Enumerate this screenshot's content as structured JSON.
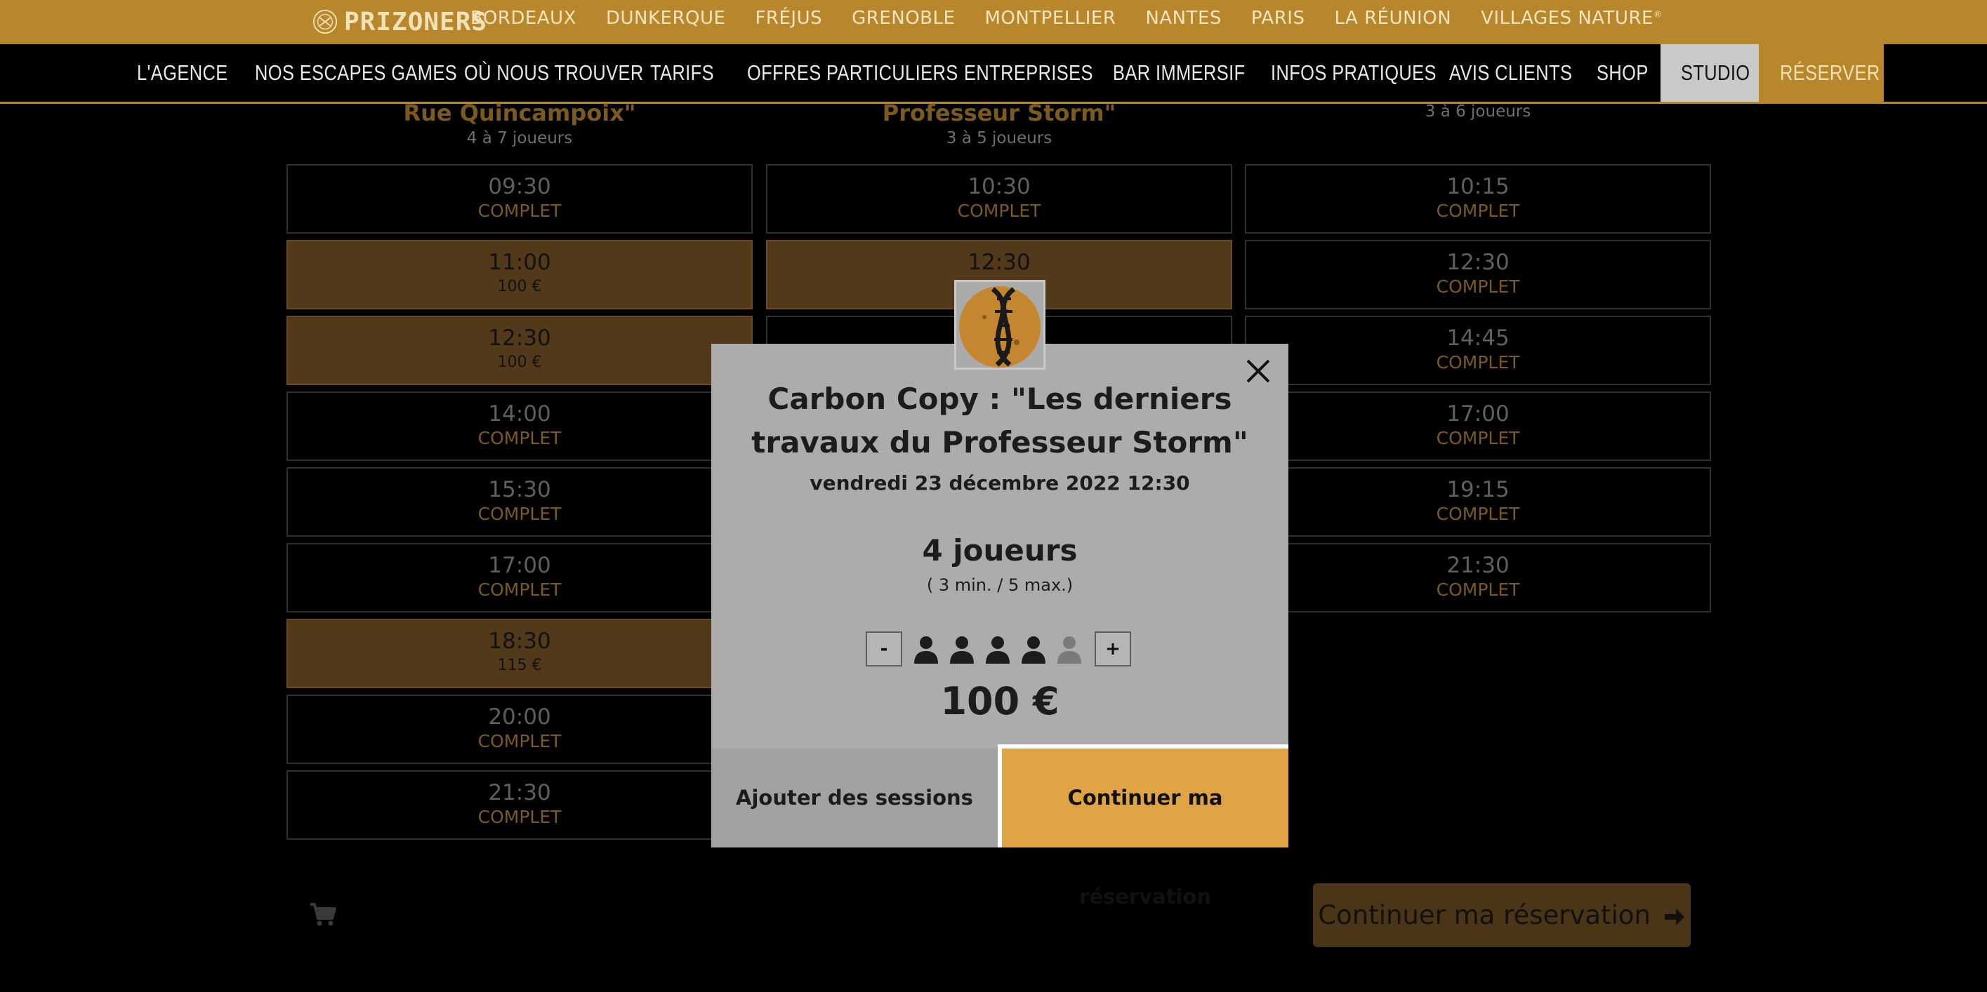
{
  "topbar": {
    "logo_text": "PRIZONERS",
    "cities": [
      "BORDEAUX",
      "DUNKERQUE",
      "FRÉJUS",
      "GRENOBLE",
      "MONTPELLIER",
      "NANTES",
      "PARIS",
      "LA RÉUNION",
      "VILLAGES NATURE"
    ],
    "cities_suffix": "®"
  },
  "nav": {
    "items": [
      "L'AGENCE",
      "NOS ESCAPES GAMES",
      "OÙ NOUS TROUVER",
      "TARIFS",
      "OFFRES PARTICULIERS",
      "ENTREPRISES",
      "BAR IMMERSIF",
      "INFOS PRATIQUES",
      "AVIS CLIENTS",
      "SHOP",
      "STUDIO",
      "RÉSERVER"
    ]
  },
  "columns": [
    {
      "title": "Rue Quincampoix\"",
      "players": "4 à 7 joueurs",
      "slots": [
        {
          "time": "09:30",
          "status": "COMPLET"
        },
        {
          "time": "11:00",
          "price": "100 €"
        },
        {
          "time": "12:30",
          "price": "100 €"
        },
        {
          "time": "14:00",
          "status": "COMPLET"
        },
        {
          "time": "15:30",
          "status": "COMPLET"
        },
        {
          "time": "17:00",
          "status": "COMPLET"
        },
        {
          "time": "18:30",
          "price": "115 €"
        },
        {
          "time": "20:00",
          "status": "COMPLET"
        },
        {
          "time": "21:30",
          "status": "COMPLET"
        }
      ]
    },
    {
      "title": "Professeur Storm\"",
      "players": "3 à 5 joueurs",
      "slots": [
        {
          "time": "10:30",
          "status": "COMPLET"
        },
        {
          "time": "12:30",
          "price": ""
        }
      ]
    },
    {
      "title": "",
      "players": "3 à 6 joueurs",
      "slots": [
        {
          "time": "10:15",
          "status": "COMPLET"
        },
        {
          "time": "12:30",
          "status": "COMPLET"
        },
        {
          "time": "14:45",
          "status": "COMPLET"
        },
        {
          "time": "17:00",
          "status": "COMPLET"
        },
        {
          "time": "19:15",
          "status": "COMPLET"
        },
        {
          "time": "21:30",
          "status": "COMPLET"
        }
      ]
    }
  ],
  "footer": {
    "continue_label": "Continuer ma réservation"
  },
  "modal": {
    "title": "Carbon Copy : \"Les derniers travaux du Professeur Storm\"",
    "date": "vendredi 23 décembre 2022 12:30",
    "players": "4 joueurs",
    "range": "( 3 min. / 5 max.)",
    "minus_label": "-",
    "plus_label": "+",
    "selected_players": 4,
    "max_players": 5,
    "price": "100 €",
    "add_sessions_label": "Ajouter des sessions",
    "continue_label": "Continuer ma réservation"
  },
  "colors": {
    "gold": "#b8862b",
    "slot_available": "#52391a",
    "modal_bg": "#acacad",
    "continue_button": "#e0a445"
  }
}
